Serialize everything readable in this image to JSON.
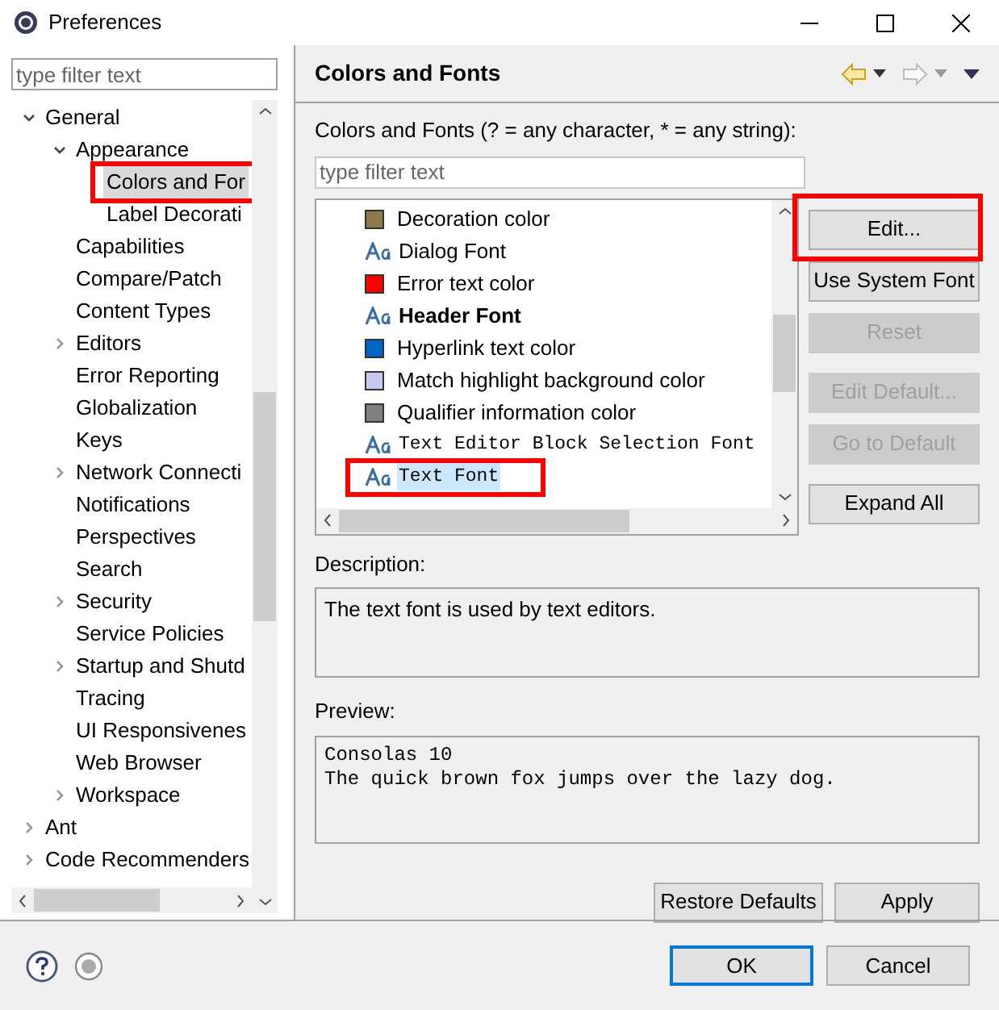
{
  "window": {
    "title": "Preferences"
  },
  "sidebar": {
    "filter": {
      "placeholder": "type filter text"
    },
    "tree": [
      {
        "label": "General",
        "expanded": true,
        "children": [
          {
            "label": "Appearance",
            "expanded": true,
            "children": [
              {
                "label": "Colors and For",
                "selected": true,
                "annotated": true
              },
              {
                "label": "Label Decorati",
                "selected": false
              }
            ]
          },
          {
            "label": "Capabilities"
          },
          {
            "label": "Compare/Patch"
          },
          {
            "label": "Content Types"
          },
          {
            "label": "Editors",
            "expanded": false
          },
          {
            "label": "Error Reporting"
          },
          {
            "label": "Globalization"
          },
          {
            "label": "Keys"
          },
          {
            "label": "Network Connecti",
            "expanded": false
          },
          {
            "label": "Notifications"
          },
          {
            "label": "Perspectives"
          },
          {
            "label": "Search"
          },
          {
            "label": "Security",
            "expanded": false
          },
          {
            "label": "Service Policies"
          },
          {
            "label": "Startup and Shutd",
            "expanded": false
          },
          {
            "label": "Tracing"
          },
          {
            "label": "UI Responsivenes"
          },
          {
            "label": "Web Browser"
          },
          {
            "label": "Workspace",
            "expanded": false
          }
        ]
      },
      {
        "label": "Ant",
        "expanded": false
      },
      {
        "label": "Code Recommenders",
        "expanded": false
      }
    ]
  },
  "page": {
    "title": "Colors and Fonts",
    "filter_label": "Colors and Fonts (? = any character, * = any string):",
    "filter": {
      "placeholder": "type filter text"
    },
    "items": [
      {
        "kind": "color",
        "label": "Decoration color",
        "color": "#8b7a4a",
        "selected": false
      },
      {
        "kind": "font",
        "label": "Dialog Font",
        "selected": false
      },
      {
        "kind": "color",
        "label": "Error text color",
        "color": "#ff0000",
        "selected": false
      },
      {
        "kind": "bold-font",
        "label": "Header Font",
        "selected": false
      },
      {
        "kind": "color",
        "label": "Hyperlink text color",
        "color": "#0066cc",
        "selected": false
      },
      {
        "kind": "color",
        "label": "Match highlight background color",
        "color": "#c8c8f0",
        "selected": false
      },
      {
        "kind": "color",
        "label": "Qualifier information color",
        "color": "#808080",
        "selected": false
      },
      {
        "kind": "mono-font",
        "label": "Text Editor Block Selection Font",
        "selected": false
      },
      {
        "kind": "mono-font",
        "label": "Text Font",
        "selected": true,
        "annotated": true
      }
    ],
    "buttons": [
      {
        "label": "Edit...",
        "disabled": false,
        "annotated": true
      },
      {
        "label": "Use System Font",
        "disabled": false
      },
      {
        "label": "Reset",
        "disabled": true
      },
      {
        "label": "Edit Default...",
        "disabled": true
      },
      {
        "label": "Go to Default",
        "disabled": true
      },
      {
        "label": "Expand All",
        "disabled": false
      }
    ],
    "description_label": "Description:",
    "description": "The text font is used by text editors.",
    "preview_label": "Preview:",
    "preview": [
      "Consolas 10",
      "The quick brown fox jumps over the lazy dog."
    ],
    "actions": [
      "Restore Defaults",
      "Apply"
    ]
  },
  "footer": {
    "buttons": [
      {
        "label": "OK",
        "default": true
      },
      {
        "label": "Cancel",
        "default": false
      }
    ]
  }
}
